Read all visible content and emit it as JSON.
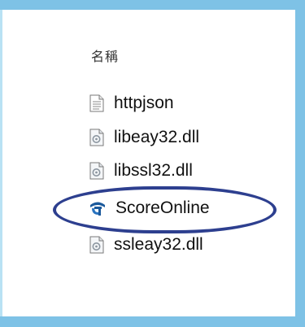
{
  "explorer": {
    "column_header": "名稱",
    "files": [
      {
        "name": "httpjson",
        "icon": "text-file-icon"
      },
      {
        "name": "libeay32.dll",
        "icon": "dll-file-icon"
      },
      {
        "name": "libssl32.dll",
        "icon": "dll-file-icon"
      },
      {
        "name": "ScoreOnline",
        "icon": "app-icon"
      },
      {
        "name": "ssleay32.dll",
        "icon": "dll-file-icon"
      }
    ]
  },
  "colors": {
    "frame": "#7ec2e6",
    "highlight": "#2d3f8f",
    "app_icon": "#1c5a9c"
  }
}
